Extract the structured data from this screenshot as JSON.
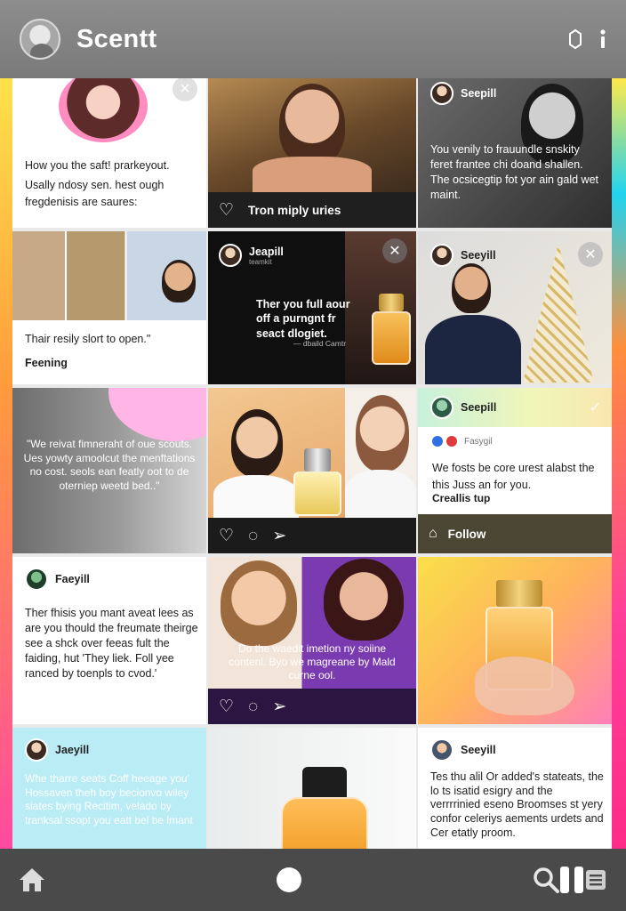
{
  "app": {
    "title": "Scentt"
  },
  "header": {
    "notification_icon": "bell-outline-icon",
    "info_icon": "info-icon"
  },
  "cards": {
    "c1": {
      "caption": "How you the saft! prarkeyout.",
      "text": "Usally ndosy sen. hest ough fregdenisis are saures:"
    },
    "c2": {
      "label": "Tron miply uries"
    },
    "c3": {
      "username": "Seepill",
      "text": "You venily to frauundle snskity feret frantee chi doand shallen. The ocsicegtip fot yor ain gald wet maint."
    },
    "c4": {
      "caption": "Thair resily slort to open.\"",
      "label": "Feening"
    },
    "c5": {
      "username": "Jeapill",
      "subtitle": "teamkit",
      "quote": "Ther you full aour off a purngnt fr seact dlogiet.",
      "attribution": "— dbaild Camtr"
    },
    "c6": {
      "username": "Seeyill"
    },
    "c7": {
      "quote": "\"We reivat fimneraht of oue scouts. Ues yowty amoolcut the menftations no cost. seols ean featly oot to de oterniep weetd bed..\""
    },
    "c9": {
      "username": "Seepill",
      "handle": "Fasygil",
      "text": "We fosts be core urest alabst the this Juss an for you.",
      "bold": "Creallis tup",
      "follow_label": "Follow"
    },
    "c10": {
      "username": "Faeyill",
      "text": "Ther fhisis you mant aveat lees as are you thould the freumate theirge see a shck over feeas fult the faiding, hut 'They liek. Foll yee ranced by toenpls to cvod.'"
    },
    "c11": {
      "quote": "Do the waedit imetion ny soiine contenl. Byo we magreane by Mald curne ool."
    },
    "c13": {
      "username": "Jaeyill",
      "text": "Whe tharre seats Coff heeage you' Hossaven theh boy becionvo wiley siates bying Recitim, velado by tranksal ssopt you eatt bel be lmant"
    },
    "c15": {
      "username": "Seeyill",
      "text": "Tes thu alil Or added's stateats, the lo ts isatid esigry and the verrrrinied eseno Broomses st yery confor celeriys aements urdets and Cer etatly proom."
    }
  },
  "nav": {
    "home_icon": "home-icon",
    "record_icon": "circle-icon",
    "search_icon": "search-icon",
    "pause_icon": "pause-icon",
    "list_icon": "list-icon"
  },
  "colors": {
    "header_bg": "#8d8d8d",
    "nav_bg": "#4a4a4a",
    "accent_pink": "#ff2e93",
    "accent_yellow": "#f6d63a",
    "accent_cyan": "#22d3f0"
  }
}
